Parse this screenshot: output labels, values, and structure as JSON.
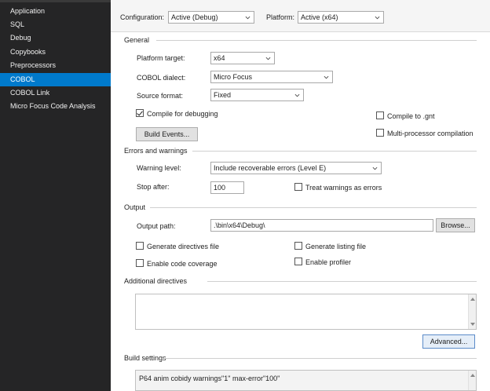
{
  "sidebar": {
    "items": [
      {
        "label": "Application"
      },
      {
        "label": "SQL"
      },
      {
        "label": "Debug"
      },
      {
        "label": "Copybooks"
      },
      {
        "label": "Preprocessors"
      },
      {
        "label": "COBOL"
      },
      {
        "label": "COBOL Link"
      },
      {
        "label": "Micro Focus Code Analysis"
      }
    ],
    "selected": "COBOL"
  },
  "topbar": {
    "configuration_label": "Configuration:",
    "configuration_value": "Active (Debug)",
    "platform_label": "Platform:",
    "platform_value": "Active (x64)"
  },
  "general": {
    "title": "General",
    "platform_target_label": "Platform target:",
    "platform_target_value": "x64",
    "cobol_dialect_label": "COBOL dialect:",
    "cobol_dialect_value": "Micro Focus",
    "source_format_label": "Source format:",
    "source_format_value": "Fixed",
    "compile_debug_label": "Compile for debugging",
    "compile_debug_checked": true,
    "compile_gnt_label": "Compile to .gnt",
    "compile_gnt_checked": false,
    "multiproc_label": "Multi-processor compilation",
    "multiproc_checked": false,
    "build_events_label": "Build Events..."
  },
  "errors": {
    "title": "Errors and warnings",
    "warning_level_label": "Warning level:",
    "warning_level_value": "Include recoverable errors (Level E)",
    "stop_after_label": "Stop after:",
    "stop_after_value": "100",
    "treat_warnings_label": "Treat warnings as errors",
    "treat_warnings_checked": false
  },
  "output": {
    "title": "Output",
    "output_path_label": "Output path:",
    "output_path_value": ".\\bin\\x64\\Debug\\",
    "browse_label": "Browse...",
    "gen_directives_label": "Generate directives file",
    "gen_listing_label": "Generate listing file",
    "code_coverage_label": "Enable code coverage",
    "profiler_label": "Enable profiler"
  },
  "additional": {
    "title": "Additional directives",
    "value": "",
    "advanced_label": "Advanced..."
  },
  "build": {
    "title": "Build settings",
    "value": "P64 anim cobidy warnings\"1\" max-error\"100\""
  },
  "colors": {
    "sidebar_bg": "#252526",
    "selected_bg": "#007acc",
    "panel_bg": "#ffffff"
  }
}
